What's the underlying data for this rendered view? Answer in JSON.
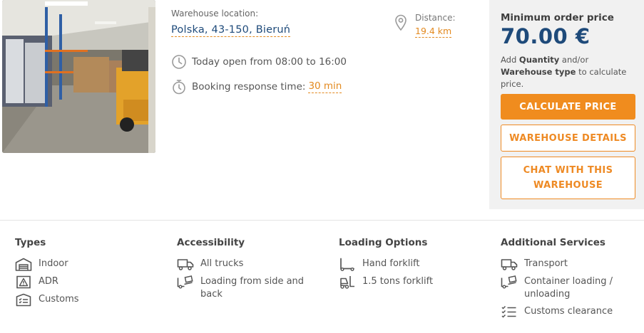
{
  "location": {
    "label": "Warehouse location:",
    "value": "Polska, 43-150, Bieruń"
  },
  "distance": {
    "label": "Distance:",
    "value": "19.4 km",
    "icon": "map-pin-icon"
  },
  "hours": {
    "text": "Today open from 08:00 to 16:00",
    "icon": "clock-icon"
  },
  "booking": {
    "label": "Booking response time:",
    "value": "30 min",
    "icon": "stopwatch-icon"
  },
  "price": {
    "title": "Minimum order price",
    "value": "70.00 €",
    "note_prefix": "Add",
    "note_b1": "Quantity",
    "note_mid": "and/or",
    "note_b2": "Warehouse type",
    "note_suffix": "to calculate price."
  },
  "buttons": {
    "calculate": "CALCULATE PRICE",
    "details": "WAREHOUSE DETAILS",
    "chat": "CHAT WITH THIS WAREHOUSE"
  },
  "features": {
    "types": {
      "title": "Types",
      "items": [
        {
          "label": "Indoor",
          "icon": "warehouse-icon"
        },
        {
          "label": "ADR",
          "icon": "hazard-icon"
        },
        {
          "label": "Customs",
          "icon": "customs-icon"
        }
      ]
    },
    "accessibility": {
      "title": "Accessibility",
      "items": [
        {
          "label": "All trucks",
          "icon": "truck-icon"
        },
        {
          "label": "Loading from side and back",
          "icon": "forklift-boxes-icon"
        }
      ]
    },
    "loading": {
      "title": "Loading Options",
      "items": [
        {
          "label": "Hand forklift",
          "icon": "hand-forklift-icon"
        },
        {
          "label": "1.5 tons forklift",
          "icon": "forklift-icon"
        }
      ]
    },
    "services": {
      "title": "Additional Services",
      "items": [
        {
          "label": "Transport",
          "icon": "truck-icon"
        },
        {
          "label": "Container loading / unloading",
          "icon": "forklift-boxes-icon"
        },
        {
          "label": "Customs clearance",
          "icon": "checklist-icon"
        }
      ]
    }
  },
  "colors": {
    "accent": "#f08c1e",
    "brand": "#1e4a7a",
    "panel": "#f1f1f1"
  }
}
